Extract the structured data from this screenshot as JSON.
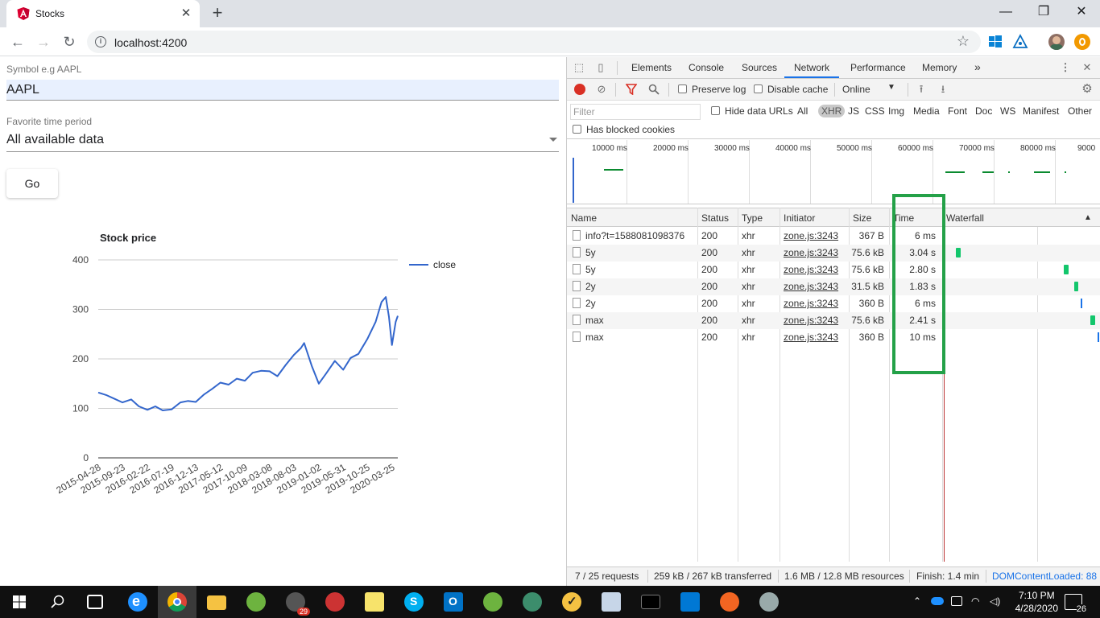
{
  "browser": {
    "tab_title": "Stocks",
    "url": "localhost:4200"
  },
  "form": {
    "symbol_label": "Symbol e.g AAPL",
    "symbol_value": "AAPL",
    "period_label": "Favorite time period",
    "period_value": "All available data",
    "go_label": "Go"
  },
  "chart_data": {
    "type": "line",
    "title": "Stock price",
    "xlabel": "",
    "ylabel": "",
    "ylim": [
      0,
      400
    ],
    "yticks": [
      0,
      100,
      200,
      300,
      400
    ],
    "xticks": [
      "2015-04-28",
      "2015-09-23",
      "2016-02-22",
      "2016-07-19",
      "2016-12-13",
      "2017-05-12",
      "2017-10-09",
      "2018-03-08",
      "2018-08-03",
      "2019-01-02",
      "2019-05-31",
      "2019-10-25",
      "2020-03-25"
    ],
    "legend": "right",
    "grid": true,
    "series": [
      {
        "name": "close",
        "color": "#3366cc",
        "x": [
          "2015-04-28",
          "2015-06-15",
          "2015-08-01",
          "2015-09-23",
          "2015-11-15",
          "2016-01-01",
          "2016-02-22",
          "2016-04-10",
          "2016-05-25",
          "2016-07-19",
          "2016-09-10",
          "2016-10-25",
          "2016-12-13",
          "2017-02-01",
          "2017-03-25",
          "2017-05-12",
          "2017-07-01",
          "2017-08-20",
          "2017-10-09",
          "2017-11-25",
          "2018-01-15",
          "2018-03-08",
          "2018-04-25",
          "2018-06-15",
          "2018-08-03",
          "2018-09-15",
          "2018-10-05",
          "2018-11-20",
          "2019-01-02",
          "2019-02-15",
          "2019-04-10",
          "2019-05-31",
          "2019-07-15",
          "2019-09-01",
          "2019-10-25",
          "2019-12-15",
          "2020-01-20",
          "2020-02-15",
          "2020-03-05",
          "2020-03-23",
          "2020-04-15",
          "2020-04-28"
        ],
        "y": [
          132,
          127,
          120,
          112,
          118,
          104,
          97,
          104,
          96,
          98,
          112,
          115,
          113,
          128,
          140,
          152,
          148,
          160,
          156,
          172,
          176,
          175,
          165,
          188,
          208,
          222,
          232,
          186,
          150,
          170,
          196,
          178,
          202,
          210,
          240,
          275,
          315,
          325,
          285,
          228,
          275,
          287
        ]
      }
    ]
  },
  "devtools": {
    "tabs": [
      "Elements",
      "Console",
      "Sources",
      "Network",
      "Performance",
      "Memory"
    ],
    "active_tab": "Network",
    "more_tabs": "»",
    "preserve_log": "Preserve log",
    "disable_cache": "Disable cache",
    "throttle": "Online",
    "filter_placeholder": "Filter",
    "hide_data_urls": "Hide data URLs",
    "types": [
      "All",
      "XHR",
      "JS",
      "CSS",
      "Img",
      "Media",
      "Font",
      "Doc",
      "WS",
      "Manifest",
      "Other"
    ],
    "active_type": "XHR",
    "blocked_cookies": "Has blocked cookies",
    "overview_ticks": [
      "10000 ms",
      "20000 ms",
      "30000 ms",
      "40000 ms",
      "50000 ms",
      "60000 ms",
      "70000 ms",
      "80000 ms",
      "9000"
    ],
    "columns": [
      "Name",
      "Status",
      "Type",
      "Initiator",
      "Size",
      "Time",
      "Waterfall"
    ],
    "rows": [
      {
        "name": "info?t=1588081098376",
        "status": "200",
        "type": "xhr",
        "initiator": "zone.js:3243",
        "size": "367 B",
        "time": "6 ms"
      },
      {
        "name": "5y",
        "status": "200",
        "type": "xhr",
        "initiator": "zone.js:3243",
        "size": "75.6 kB",
        "time": "3.04 s"
      },
      {
        "name": "5y",
        "status": "200",
        "type": "xhr",
        "initiator": "zone.js:3243",
        "size": "75.6 kB",
        "time": "2.80 s"
      },
      {
        "name": "2y",
        "status": "200",
        "type": "xhr",
        "initiator": "zone.js:3243",
        "size": "31.5 kB",
        "time": "1.83 s"
      },
      {
        "name": "2y",
        "status": "200",
        "type": "xhr",
        "initiator": "zone.js:3243",
        "size": "360 B",
        "time": "6 ms"
      },
      {
        "name": "max",
        "status": "200",
        "type": "xhr",
        "initiator": "zone.js:3243",
        "size": "75.6 kB",
        "time": "2.41 s"
      },
      {
        "name": "max",
        "status": "200",
        "type": "xhr",
        "initiator": "zone.js:3243",
        "size": "360 B",
        "time": "10 ms"
      }
    ],
    "status": {
      "requests": "7 / 25 requests",
      "transferred": "259 kB / 267 kB transferred",
      "resources": "1.6 MB / 12.8 MB resources",
      "finish": "Finish: 1.4 min",
      "dom_loaded": "DOMContentLoaded: 88"
    }
  },
  "taskbar": {
    "time": "7:10 PM",
    "date": "4/28/2020",
    "notifications": "26",
    "badge": "29"
  }
}
